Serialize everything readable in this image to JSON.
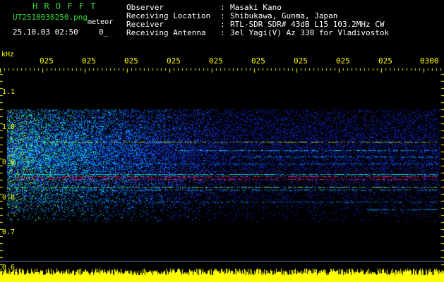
{
  "header": {
    "logo": "H R O F F T",
    "filename": "UT2510030250.png",
    "mode": "meteor",
    "datetime": "25.10.03 02:50",
    "counter": "0_",
    "info": [
      {
        "label": "Observer",
        "value": "Masaki Kano"
      },
      {
        "label": "Receiving Location",
        "value": "Shibukawa, Gunma, Japan"
      },
      {
        "label": "Receiver",
        "value": "RTL-SDR SDR# 43dB L15 103.2MHz CW"
      },
      {
        "label": "Receiving Antenna",
        "value": "3el Yagi(V) Az 330 for Vladivostok"
      }
    ]
  },
  "axis": {
    "unit": "kHz",
    "y_ticks": [
      "1.1",
      "1.0",
      "0.9",
      "0.8",
      "0.7",
      "0.6"
    ],
    "x_ticks": [
      "025",
      "025",
      "025",
      "025",
      "025",
      "025",
      "025",
      "025",
      "025",
      "0300"
    ]
  },
  "colors": {
    "header_green": "#33dd33",
    "axis_yellow": "#ffff00",
    "echo_red": "#ff2255",
    "noise_blue": "#1030ff"
  }
}
